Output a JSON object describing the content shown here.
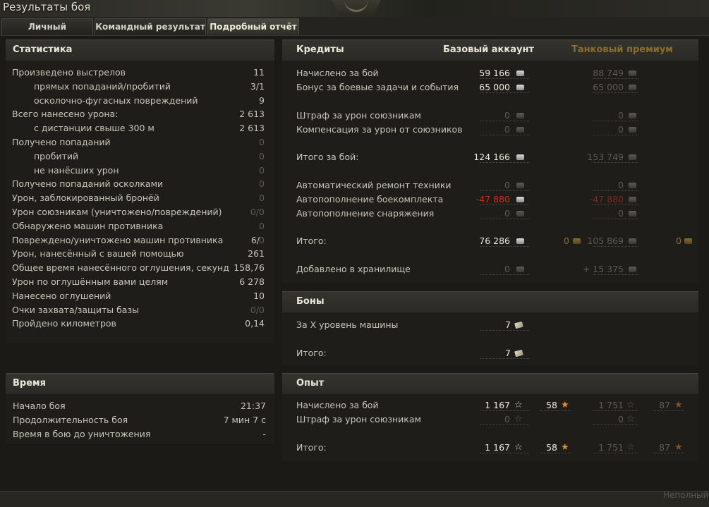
{
  "window": {
    "title": "Результаты боя"
  },
  "tabs": [
    {
      "label": "Личный результат"
    },
    {
      "label": "Командный результат"
    },
    {
      "label": "Подробный отчёт"
    }
  ],
  "stats": {
    "title": "Статистика",
    "rows": [
      {
        "label": "Произведено выстрелов",
        "value": "11"
      },
      {
        "label": "прямых попаданий/пробитий",
        "value": "3/1"
      },
      {
        "label": "осколочно-фугасных повреждений",
        "value": "9"
      },
      {
        "label": "Всего нанесено урона:",
        "value": "2 613"
      },
      {
        "label": "с дистанции свыше 300 м",
        "value": "2 613"
      },
      {
        "label": "Получено попаданий",
        "value": "0"
      },
      {
        "label": "пробитий",
        "value": "0"
      },
      {
        "label": "не нанёсших урон",
        "value": "0"
      },
      {
        "label": "Получено попаданий осколками",
        "value": "0"
      },
      {
        "label": "Урон, заблокированный бронёй",
        "value": "0"
      },
      {
        "label": "Урон союзникам (уничтожено/повреждений)",
        "value": "0/0"
      },
      {
        "label": "Обнаружено машин противника",
        "value": "0"
      },
      {
        "label": "Повреждено/уничтожено машин противника",
        "value": "6/",
        "value2": "0"
      },
      {
        "label": "Урон, нанесённый с вашей помощью",
        "value": "261"
      },
      {
        "label": "Общее время нанесённого оглушения, секунд",
        "value": "158,76"
      },
      {
        "label": "Урон по оглушённым вами целям",
        "value": "6 278"
      },
      {
        "label": "Нанесено оглушений",
        "value": "10"
      },
      {
        "label": "Очки захвата/защиты базы",
        "value": "0/0"
      },
      {
        "label": "Пройдено километров",
        "value": "0,14"
      }
    ]
  },
  "time": {
    "title": "Время",
    "rows": [
      {
        "label": "Начало боя",
        "value": "21:37"
      },
      {
        "label": "Продолжительность боя",
        "value": "7 мин 7 с"
      },
      {
        "label": "Время в бою до уничтожения",
        "value": "-"
      }
    ]
  },
  "credits": {
    "title": "Кредиты",
    "col_base": "Базовый аккаунт",
    "col_premium": "Танковый премиум",
    "rows": [
      {
        "label": "Начислено за бой",
        "base": "59 166",
        "premium": "88 749"
      },
      {
        "label": "Бонус за боевые задачи и события",
        "base": "65 000",
        "premium": "65 000"
      },
      {
        "label": "Штраф за урон союзникам",
        "base": "0",
        "premium": "0"
      },
      {
        "label": "Компенсация за урон от союзников",
        "base": "0",
        "premium": "0"
      },
      {
        "label": "Итого за бой:",
        "base": "124 166",
        "premium": "153 749"
      },
      {
        "label": "Автоматический ремонт техники",
        "base": "0",
        "premium": "0"
      },
      {
        "label": "Автопополнение боекомплекта",
        "base": "-47 880",
        "premium": "-47 880"
      },
      {
        "label": "Автопополнение снаряжения",
        "base": "0",
        "premium": "0"
      },
      {
        "label": "Итого:",
        "base": "76 286",
        "base_gold": "0",
        "premium": "105 869",
        "premium_gold": "0"
      },
      {
        "label": "Добавлено в хранилище",
        "base": "0",
        "premium": "+ 15 375"
      }
    ]
  },
  "bonds": {
    "title": "Боны",
    "rows": [
      {
        "label": "За X уровень машины",
        "value": "7"
      },
      {
        "label": "Итого:",
        "value": "7"
      }
    ]
  },
  "xp": {
    "title": "Опыт",
    "rows": [
      {
        "label": "Начислено за бой",
        "base": "1 167",
        "base_free": "58",
        "premium": "1 751",
        "premium_free": "87"
      },
      {
        "label": "Штраф за урон союзникам",
        "base": "0",
        "premium": "0"
      },
      {
        "label": "Итого:",
        "base": "1 167",
        "base_free": "58",
        "premium": "1 751",
        "premium_free": "87"
      }
    ]
  },
  "footer": {
    "incomplete_label": "Неполный"
  },
  "icons": {
    "credit": "credit-coin-icon",
    "gold": "gold-coin-icon",
    "bond": "bond-icon",
    "xp": "star-icon",
    "free_xp": "free-xp-star-icon"
  }
}
